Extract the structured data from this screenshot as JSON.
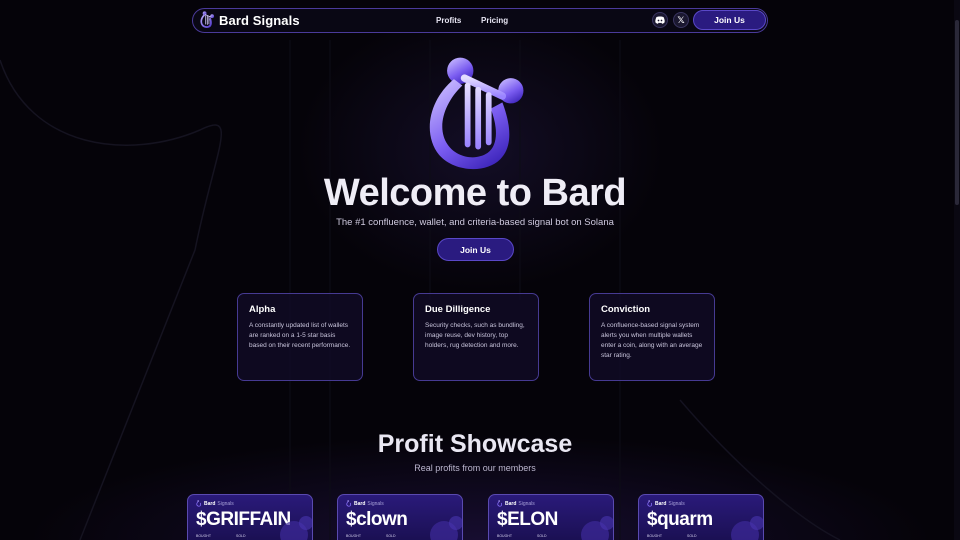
{
  "nav": {
    "brand_name": "Bard Signals",
    "links": [
      "Profits",
      "Pricing"
    ],
    "join_label": "Join Us",
    "icons": [
      "discord-icon",
      "x-icon"
    ]
  },
  "hero": {
    "title": "Welcome to Bard",
    "subtitle": "The #1 confluence, wallet, and criteria-based signal bot on Solana",
    "join_label": "Join Us"
  },
  "features": [
    {
      "title": "Alpha",
      "text": "A constantly updated list of wallets are ranked on a 1-5 star basis based on their recent performance."
    },
    {
      "title": "Due Dilligence",
      "text": "Security checks, such as bundling, image reuse, dev history, top holders, rug detection and more."
    },
    {
      "title": "Conviction",
      "text": "A confluence-based signal system alerts you when multiple wallets enter a coin, along with an average star rating."
    }
  ],
  "showcase": {
    "title": "Profit Showcase",
    "subtitle": "Real profits from our members",
    "card_brand": "Bard",
    "card_brand_sub": "Signals",
    "bought_label": "BOUGHT",
    "sold_label": "SOLD",
    "cards": [
      {
        "ticker": "$GRIFFAIN"
      },
      {
        "ticker": "$clown"
      },
      {
        "ticker": "$ELON"
      },
      {
        "ticker": "$quarm"
      }
    ]
  },
  "colors": {
    "background": "#050309",
    "accent": "#2a1b80",
    "border": "#463a92",
    "logo_gradient_start": "#b7a6ff",
    "logo_gradient_end": "#3a22b8"
  }
}
